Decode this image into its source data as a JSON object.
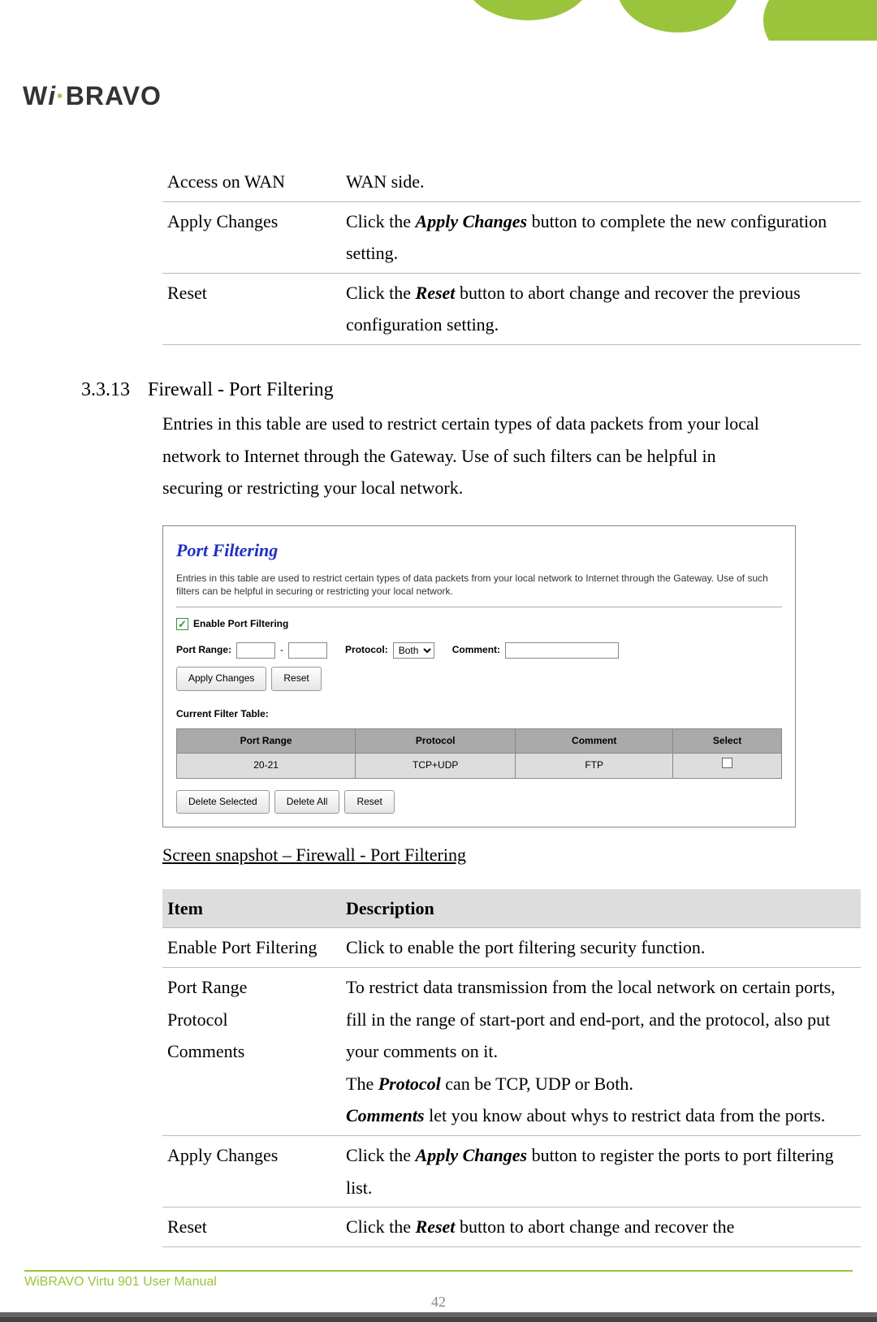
{
  "logo": {
    "part1": "W",
    "part2": "i",
    "part3": "BRAVO"
  },
  "top_table": {
    "rows": [
      {
        "item": "Access on WAN",
        "desc_plain": "WAN side."
      },
      {
        "item": "Apply Changes",
        "desc_pre": "Click the ",
        "desc_bold": "Apply Changes",
        "desc_post": " button to complete the new configuration setting."
      },
      {
        "item": "Reset",
        "desc_pre": "Click the ",
        "desc_bold": "Reset",
        "desc_post": " button to abort change and recover the previous configuration setting."
      }
    ]
  },
  "section": {
    "number": "3.3.13",
    "title": "Firewall - Port Filtering",
    "body": "Entries in this table are used to restrict certain types of data packets from your local network to Internet through the Gateway. Use of such filters can be helpful in securing or restricting your local network."
  },
  "screenshot": {
    "title": "Port Filtering",
    "desc": "Entries in this table are used to restrict certain types of data packets from your local network to Internet through the Gateway. Use of such filters can be helpful in securing or restricting your local network.",
    "check_label": "Enable Port Filtering",
    "port_range_label": "Port Range:",
    "dash": "-",
    "protocol_label": "Protocol:",
    "protocol_value": "Both",
    "comment_label": "Comment:",
    "btn_apply": "Apply Changes",
    "btn_reset": "Reset",
    "table_caption": "Current Filter Table:",
    "headers": {
      "c1": "Port Range",
      "c2": "Protocol",
      "c3": "Comment",
      "c4": "Select"
    },
    "row1": {
      "c1": "20-21",
      "c2": "TCP+UDP",
      "c3": "FTP"
    },
    "btn_del_sel": "Delete Selected",
    "btn_del_all": "Delete All",
    "btn_reset2": "Reset"
  },
  "caption": "Screen snapshot – Firewall - Port Filtering",
  "desc_table": {
    "head": {
      "c1": "Item",
      "c2": "Description"
    },
    "rows": [
      {
        "item": "Enable Port Filtering",
        "desc_plain": "Click to enable the port filtering security function."
      },
      {
        "item_l1": "Port Range",
        "item_l2": "Protocol",
        "item_l3": "Comments",
        "d_p1": "To restrict data transmission from the local network on certain ports, fill in the range of start-port and end-port, and the protocol, also put your comments on it.",
        "d_p2_pre": "The ",
        "d_p2_bold": "Protocol",
        "d_p2_post": " can be TCP, UDP or Both.",
        "d_p3_bold": "Comments",
        "d_p3_post": " let you know about whys to restrict data from the ports."
      },
      {
        "item": "Apply Changes",
        "desc_pre": "Click the ",
        "desc_bold": "Apply Changes",
        "desc_post": " button to register the ports to port filtering list."
      },
      {
        "item": "Reset",
        "desc_pre": "Click the ",
        "desc_bold": "Reset",
        "desc_post": " button to abort change and recover the"
      }
    ]
  },
  "footer": "WiBRAVO Virtu 901 User Manual",
  "page": "42"
}
